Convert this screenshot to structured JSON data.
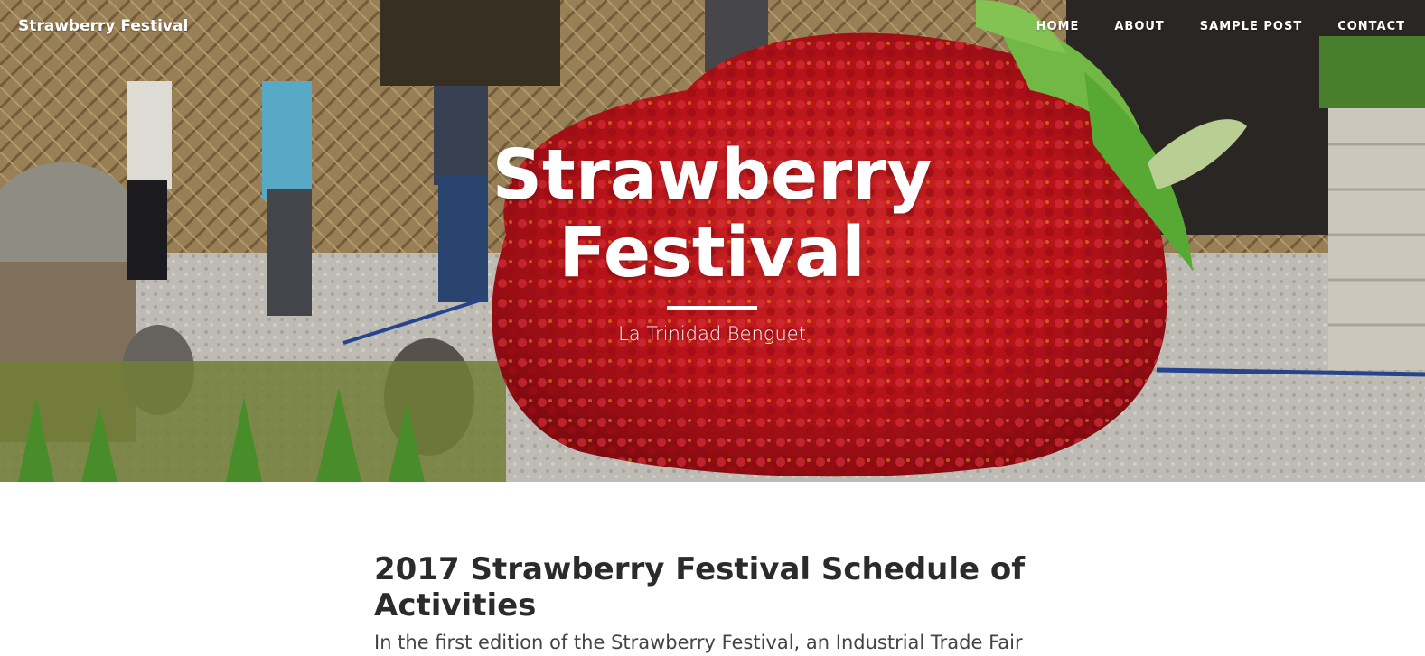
{
  "site": {
    "brand": "Strawberry Festival"
  },
  "nav": {
    "items": [
      {
        "label": "HOME"
      },
      {
        "label": "ABOUT"
      },
      {
        "label": "SAMPLE POST"
      },
      {
        "label": "CONTACT"
      }
    ]
  },
  "hero": {
    "title": "Strawberry Festival",
    "subtitle": "La Trinidad Benguet"
  },
  "post": {
    "title": "2017 Strawberry Festival Schedule of Activities",
    "excerpt": "In the first edition of the Strawberry Festival, an Industrial Trade Fair"
  },
  "colors": {
    "nav_text": "#ffffff",
    "heading": "#2b2b2b",
    "body_text": "#444444",
    "strawberry_red": "#c8141c"
  }
}
